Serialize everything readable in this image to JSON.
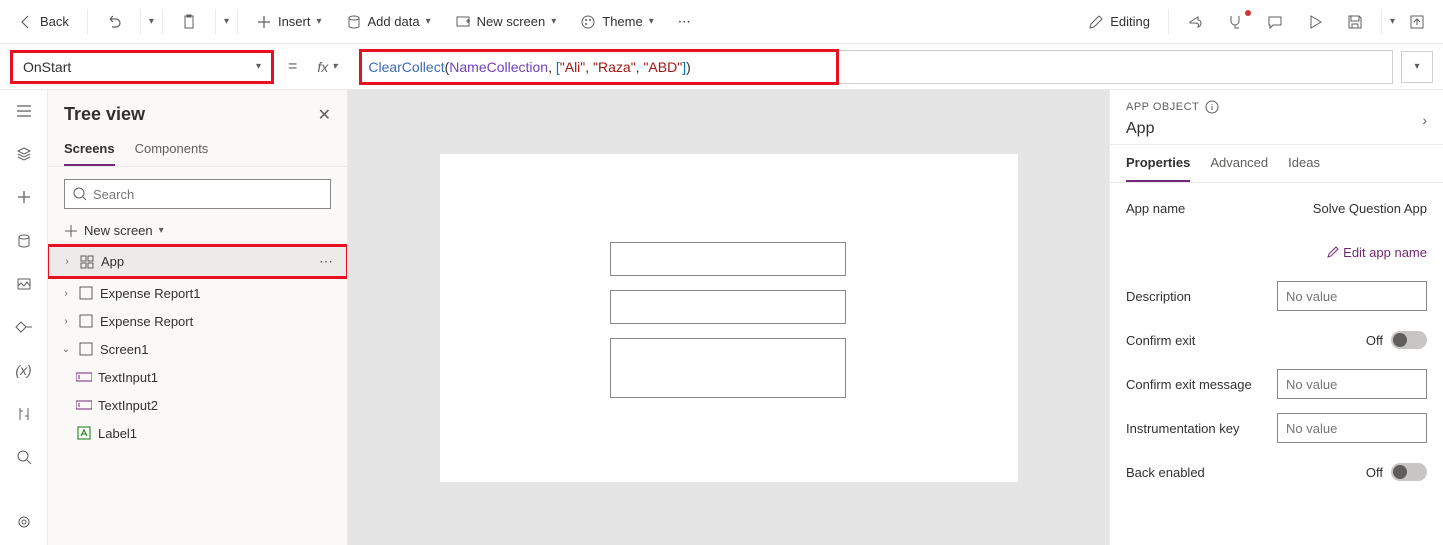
{
  "topbar": {
    "back": "Back",
    "insert": "Insert",
    "add_data": "Add data",
    "new_screen": "New screen",
    "theme": "Theme",
    "editing": "Editing"
  },
  "formula": {
    "property": "OnStart",
    "fn": "ClearCollect",
    "variable": "NameCollection",
    "str1": "\"Ali\"",
    "str2": "\"Raza\"",
    "str3": "\"ABD\""
  },
  "tree": {
    "title": "Tree view",
    "tabs": {
      "screens": "Screens",
      "components": "Components"
    },
    "search_placeholder": "Search",
    "new_screen": "New screen",
    "items": {
      "app": "App",
      "er1": "Expense Report1",
      "er": "Expense Report",
      "screen1": "Screen1",
      "ti1": "TextInput1",
      "ti2": "TextInput2",
      "lbl1": "Label1"
    }
  },
  "props": {
    "header_obj": "APP OBJECT",
    "header_name": "App",
    "tabs": {
      "properties": "Properties",
      "advanced": "Advanced",
      "ideas": "Ideas"
    },
    "app_name_label": "App name",
    "app_name_value": "Solve Question App",
    "edit_name": "Edit app name",
    "description_label": "Description",
    "no_value": "No value",
    "confirm_exit_label": "Confirm exit",
    "confirm_exit_msg_label": "Confirm exit message",
    "instr_key_label": "Instrumentation key",
    "back_enabled_label": "Back enabled",
    "off": "Off"
  }
}
